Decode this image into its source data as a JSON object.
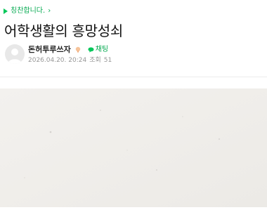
{
  "breadcrumb": {
    "label": "칭찬합니다."
  },
  "post": {
    "title": "어학생활의 흥망성쇠",
    "author": {
      "name": "돈허투루쓰자",
      "chat_label": "채팅"
    },
    "date": "2026.04.20. 20:24",
    "views_label": "조회",
    "views": "51"
  },
  "colors": {
    "accent": "#03c75a",
    "meta": "#979797",
    "photo_bg": "#f1efec"
  }
}
